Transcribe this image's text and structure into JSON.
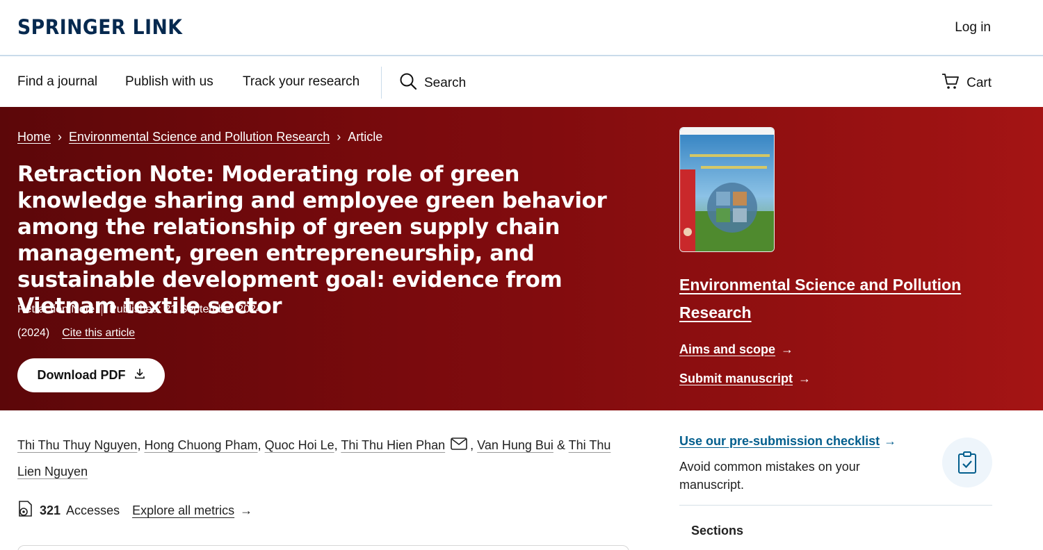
{
  "header": {
    "logo": "SPRINGER LINK",
    "login": "Log in"
  },
  "nav": {
    "items": [
      "Find a journal",
      "Publish with us",
      "Track your research"
    ],
    "search": "Search",
    "cart": "Cart"
  },
  "breadcrumb": {
    "home": "Home",
    "journal": "Environmental Science and Pollution Research",
    "current": "Article"
  },
  "article": {
    "title": "Retraction Note: Moderating role of green knowledge sharing and employee green behavior among the relationship of green supply chain management, green entrepreneurship, and sustainable development goal: evidence from Vietnam textile sector",
    "type": "Retraction Note",
    "published": "Published: 21 September 2024",
    "year": "(2024)",
    "cite": "Cite this article",
    "download": "Download PDF"
  },
  "journal_panel": {
    "name": "Environmental Science and Pollution Research",
    "aims": "Aims and scope",
    "submit": "Submit manuscript"
  },
  "authors": {
    "list": [
      "Thi Thu Thuy Nguyen",
      "Hong Chuong Pham",
      "Quoc Hoi Le",
      "Thi Thu Hien Phan",
      "Van Hung Bui",
      "Thi Thu Lien Nguyen"
    ],
    "separator_comma": ",",
    "separator_and": "&"
  },
  "metrics": {
    "accesses_count": "321",
    "accesses_label": "Accesses",
    "explore": "Explore all metrics"
  },
  "sidebar": {
    "checklist_link": "Use our pre-submission checklist",
    "checklist_desc": "Avoid common mistakes on your manuscript.",
    "sections": "Sections"
  },
  "colors": {
    "brand_navy": "#06294f",
    "hero_red": "#8e0f10",
    "link_blue": "#025e8d"
  }
}
